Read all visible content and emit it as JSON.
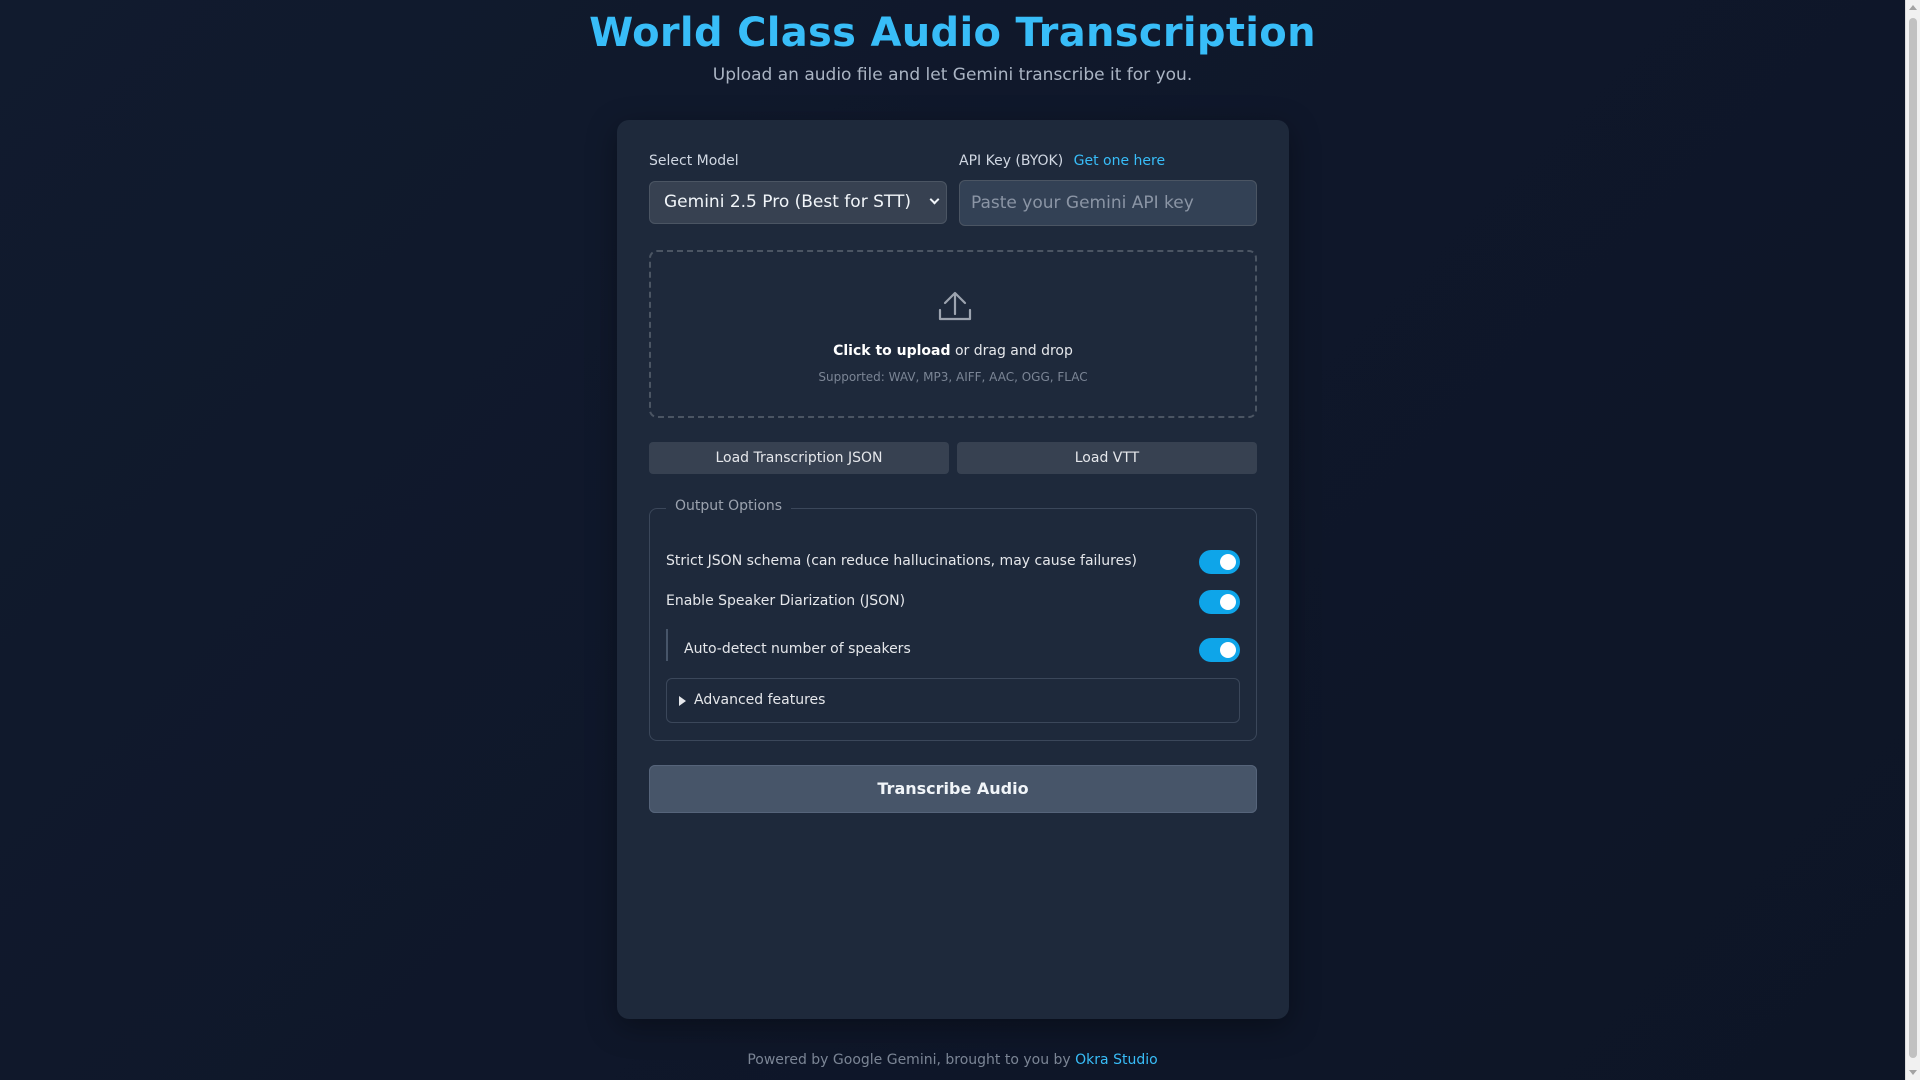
{
  "header": {
    "title": "World Class Audio Transcription",
    "subtitle": "Upload an audio file and let Gemini transcribe it for you."
  },
  "model": {
    "label": "Select Model",
    "selected": "Gemini 2.5 Pro (Best for STT)"
  },
  "api_key": {
    "label": "API Key (BYOK)",
    "link_text": "Get one here",
    "placeholder": "Paste your Gemini API key",
    "value": ""
  },
  "upload": {
    "icon": "upload-icon",
    "action_text": "Click to upload",
    "rest_text": " or drag and drop",
    "supported": "Supported: WAV, MP3, AIFF, AAC, OGG, FLAC"
  },
  "load_buttons": {
    "json_label": "Load Transcription JSON",
    "vtt_label": "Load VTT"
  },
  "output_options": {
    "legend": "Output Options",
    "strict_json": {
      "label": "Strict JSON schema (can reduce hallucinations, may cause failures)",
      "on": true
    },
    "diarization": {
      "label": "Enable Speaker Diarization (JSON)",
      "on": true
    },
    "auto_detect": {
      "label": "Auto-detect number of speakers",
      "on": true
    },
    "advanced_label": "Advanced features"
  },
  "transcribe_button": "Transcribe Audio",
  "footer": {
    "text": "Powered by Google Gemini, brought to you by",
    "link_text": "Okra Studio"
  },
  "colors": {
    "accent": "#38bdf8",
    "toggle_on": "#0ea5e9",
    "card_bg": "#1e293b",
    "page_bg": "#0f172a"
  }
}
